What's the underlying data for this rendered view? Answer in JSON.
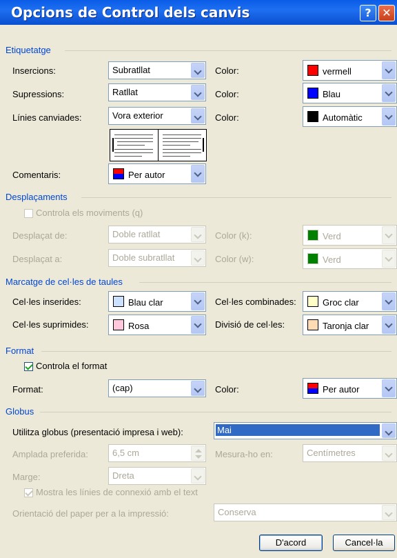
{
  "window": {
    "title": "Opcions de Control dels canvis",
    "help_glyph": "?",
    "close_glyph": "✕"
  },
  "etiquetatge": {
    "heading": "Etiquetatge",
    "insercions": {
      "label": "Insercions:",
      "value": "Subratllat",
      "color_label": "Color:",
      "color_value": "vermell",
      "swatch": "#ff0000"
    },
    "supressions": {
      "label": "Supressions:",
      "value": "Ratllat",
      "color_label": "Color:",
      "color_value": "Blau",
      "swatch": "#0000ff"
    },
    "linies": {
      "label": "Línies canviades:",
      "value": "Vora exterior",
      "color_label": "Color:",
      "color_value": "Automàtic",
      "swatch": "#000000"
    },
    "comentaris": {
      "label": "Comentaris:",
      "value": "Per autor"
    }
  },
  "desplacaments": {
    "heading": "Desplaçaments",
    "track_label": "Controla els moviments (q)",
    "track_checked": false,
    "de": {
      "label": "Desplaçat de:",
      "value": "Doble ratllat",
      "color_label": "Color (k):",
      "color_value": "Verd",
      "swatch": "#008000"
    },
    "a": {
      "label": "Desplaçat a:",
      "value": "Doble subratllat",
      "color_label": "Color (w):",
      "color_value": "Verd",
      "swatch": "#008000"
    }
  },
  "celles": {
    "heading": "Marcatge de cel·les de taules",
    "inserides": {
      "label": "Cel·les inserides:",
      "value": "Blau clar",
      "swatch": "#cce0ff"
    },
    "suprimides": {
      "label": "Cel·les suprimides:",
      "value": "Rosa",
      "swatch": "#ffc8dc"
    },
    "combinades": {
      "label": "Cel·les combinades:",
      "value": "Groc clar",
      "swatch": "#ffffc8"
    },
    "divisio": {
      "label": "Divisió de cel·les:",
      "value": "Taronja clar",
      "swatch": "#ffdcb4"
    }
  },
  "format": {
    "heading": "Format",
    "track_label": "Controla el format",
    "track_checked": true,
    "label": "Format:",
    "value": "(cap)",
    "color_label": "Color:",
    "color_value": "Per autor"
  },
  "globus": {
    "heading": "Globus",
    "utilitza_label": "Utilitza globus (presentació impresa i web):",
    "utilitza_value": "Mai",
    "amplada_label": "Amplada preferida:",
    "amplada_value": "6,5 cm",
    "mesura_label": "Mesura-ho en:",
    "mesura_value": "Centímetres",
    "marge_label": "Marge:",
    "marge_value": "Dreta",
    "linies_label": "Mostra les línies de connexió amb el text",
    "linies_checked": true,
    "orientacio_label": "Orientació del paper per a la impressió:",
    "orientacio_value": "Conserva"
  },
  "buttons": {
    "ok": "D'acord",
    "cancel": "Cancel·la"
  }
}
